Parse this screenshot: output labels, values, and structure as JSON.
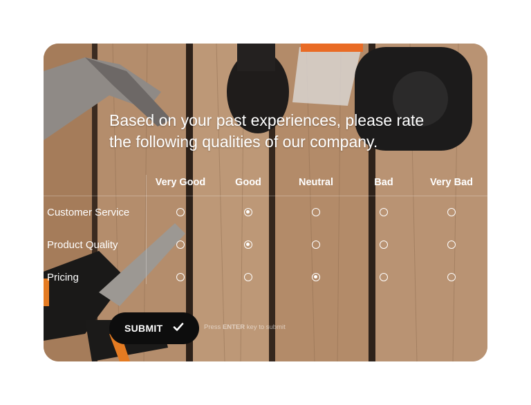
{
  "survey": {
    "question": "Based on your past experiences, please rate the following qualities of our company.",
    "columns": [
      "Very Good",
      "Good",
      "Neutral",
      "Bad",
      "Very Bad"
    ],
    "rows": [
      {
        "label": "Customer Service",
        "selected": "Good"
      },
      {
        "label": "Product Quality",
        "selected": "Good"
      },
      {
        "label": "Pricing",
        "selected": "Neutral"
      }
    ]
  },
  "submit": {
    "label": "SUBMIT",
    "hint_prefix": "Press",
    "hint_key": "ENTER",
    "hint_suffix": "key to submit"
  },
  "colors": {
    "card_background": "#b89272",
    "button": "#0d0d0d",
    "text": "#ffffff"
  },
  "icons": {
    "submit": "checkmark-icon"
  }
}
